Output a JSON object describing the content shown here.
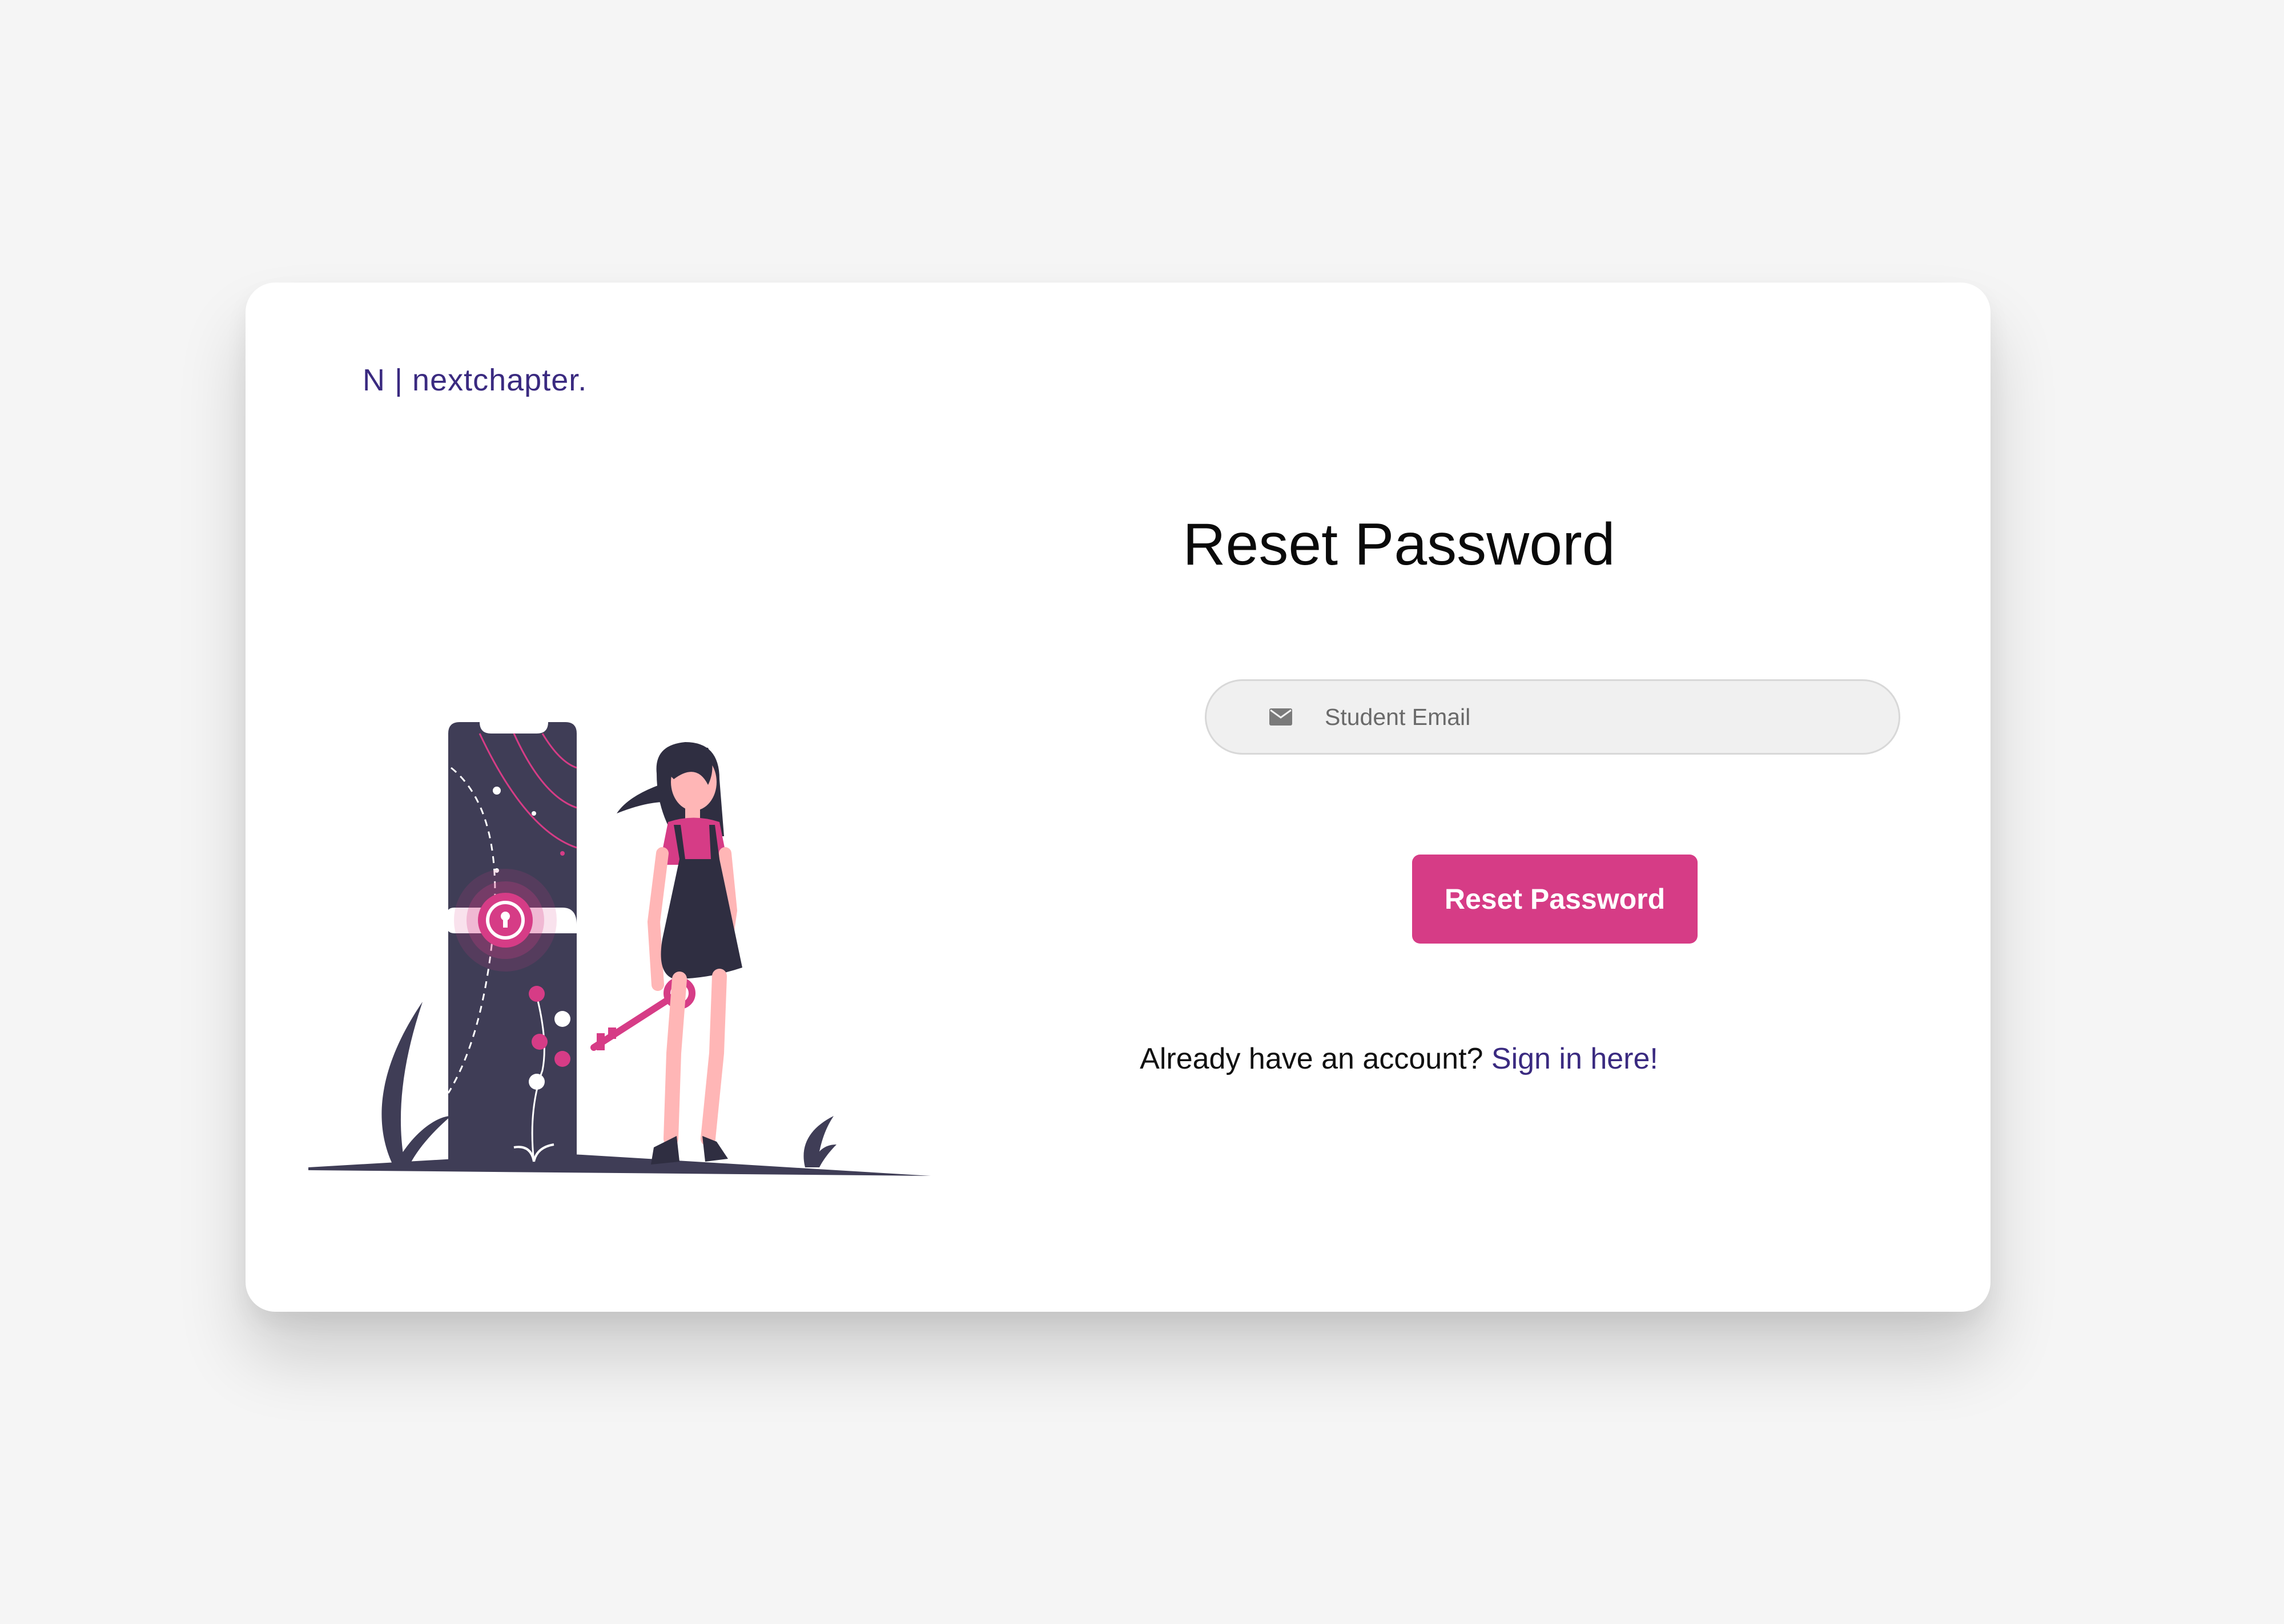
{
  "brand": {
    "text": "N | nextchapter."
  },
  "form": {
    "title": "Reset Password",
    "email_placeholder": "Student Email",
    "email_icon": "envelope-icon",
    "submit_label": "Reset Password",
    "signin_prompt": "Already have an account?",
    "signin_link": "Sign in here!"
  },
  "illustration": {
    "description_icon": "phone-lock-key-illustration"
  },
  "colors": {
    "accent": "#d63c86",
    "brand": "#3a2a80",
    "dark": "#3f3d56",
    "background": "#f5f5f5",
    "card": "#ffffff"
  }
}
